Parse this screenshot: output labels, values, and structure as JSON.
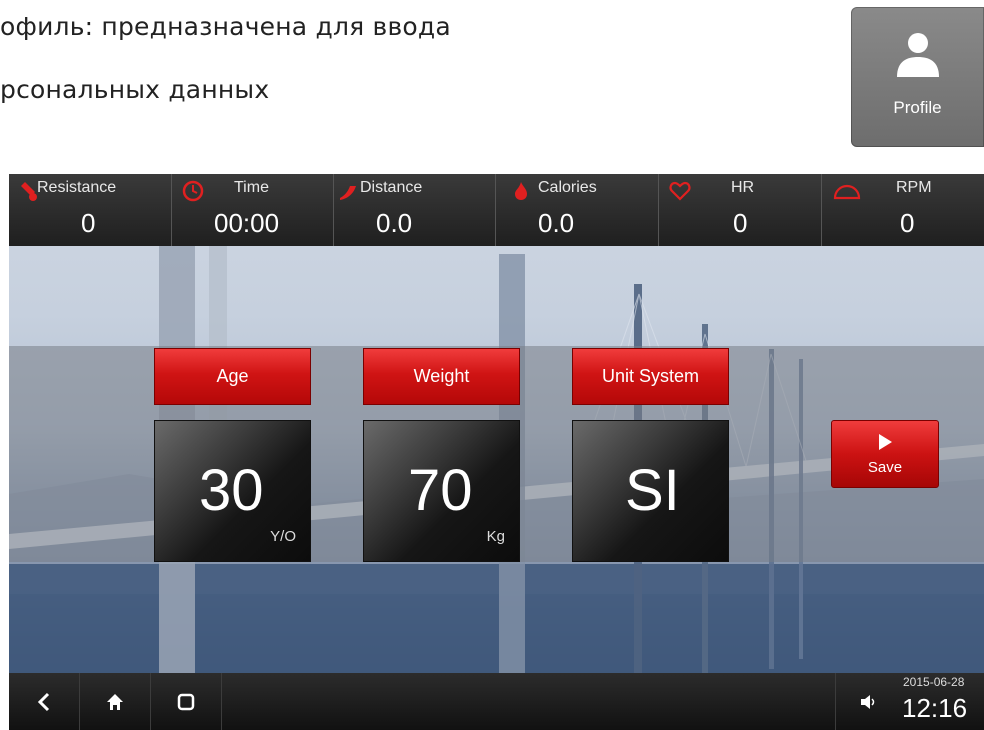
{
  "caption": {
    "line1": "офиль: предназначена для ввода",
    "line2": "рсональных данных"
  },
  "profile_tile": {
    "label": "Profile",
    "icon": "user-icon"
  },
  "stats": [
    {
      "label": "Resistance",
      "value": "0",
      "icon": "resistance-icon"
    },
    {
      "label": "Time",
      "value": "00:00",
      "icon": "clock-icon"
    },
    {
      "label": "Distance",
      "value": "0.0",
      "icon": "distance-icon"
    },
    {
      "label": "Calories",
      "value": "0.0",
      "icon": "flame-icon"
    },
    {
      "label": "HR",
      "value": "0",
      "icon": "heart-icon"
    },
    {
      "label": "RPM",
      "value": "0",
      "icon": "rpm-gauge-icon"
    }
  ],
  "fields": [
    {
      "label": "Age",
      "value": "30",
      "unit": "Y/O"
    },
    {
      "label": "Weight",
      "value": "70",
      "unit": "Kg"
    },
    {
      "label": "Unit System",
      "value": "SI",
      "unit": ""
    }
  ],
  "save": {
    "label": "Save",
    "icon": "play-icon"
  },
  "nav": {
    "back_icon": "back-icon",
    "home_icon": "home-icon",
    "recent_icon": "recent-apps-icon",
    "volume_icon": "speaker-icon",
    "date": "2015-06-28",
    "time": "12:16"
  },
  "colors": {
    "accent_red": "#d01414",
    "icon_red": "#e02020",
    "bar_dark": "#1f1f1f"
  }
}
